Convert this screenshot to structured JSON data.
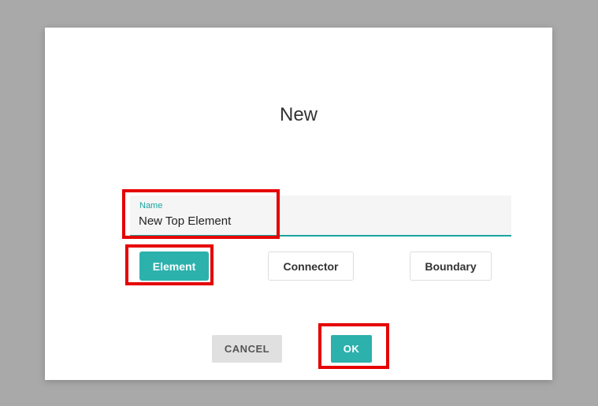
{
  "dialog": {
    "title": "New",
    "name_label": "Name",
    "name_value": "New Top Element",
    "types": {
      "element": "Element",
      "connector": "Connector",
      "boundary": "Boundary"
    },
    "actions": {
      "cancel": "CANCEL",
      "ok": "OK"
    }
  },
  "colors": {
    "accent": "#2cb1ad",
    "highlight": "#e60000"
  }
}
